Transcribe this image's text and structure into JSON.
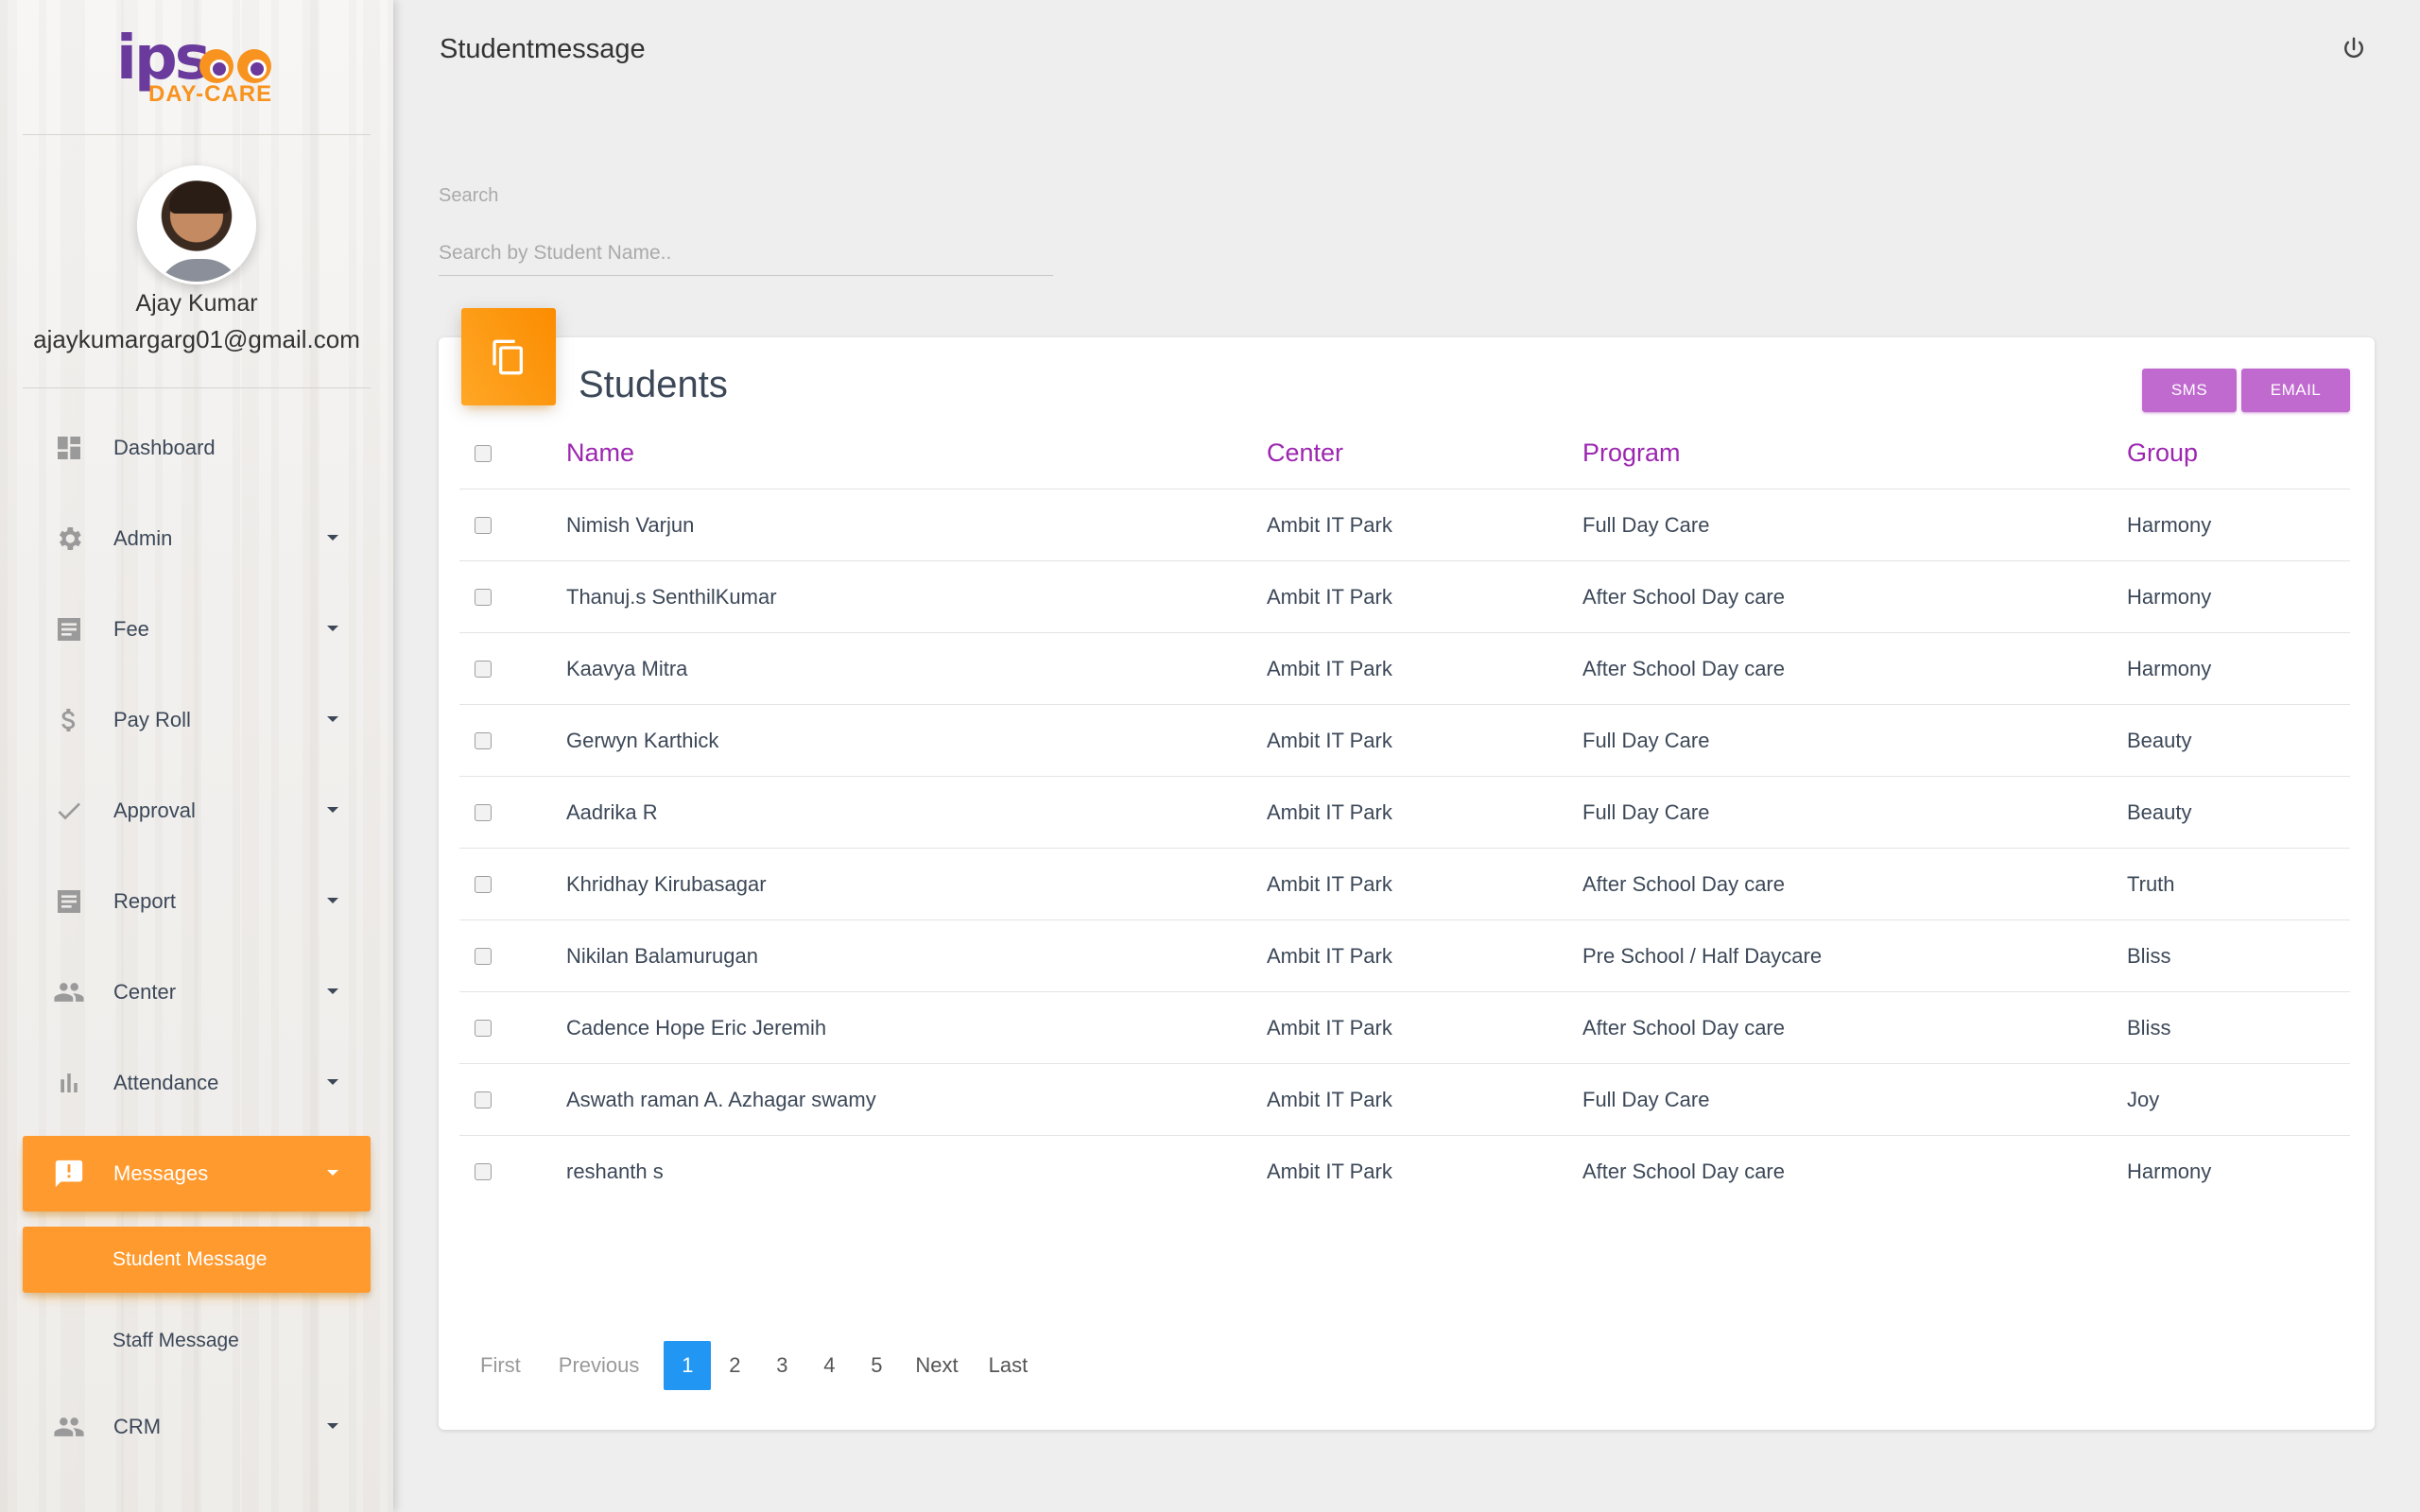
{
  "brand": {
    "logo_main": "ips",
    "logo_sub": "DAY-CARE"
  },
  "user": {
    "name": "Ajay Kumar",
    "email": "ajaykumargarg01@gmail.com"
  },
  "sidebar": {
    "items": [
      {
        "label": "Dashboard",
        "icon": "dashboard-icon"
      },
      {
        "label": "Admin",
        "icon": "gear-icon"
      },
      {
        "label": "Fee",
        "icon": "receipt-icon"
      },
      {
        "label": "Pay Roll",
        "icon": "dollar-icon"
      },
      {
        "label": "Approval",
        "icon": "check-icon"
      },
      {
        "label": "Report",
        "icon": "report-icon"
      },
      {
        "label": "Center",
        "icon": "people-icon"
      },
      {
        "label": "Attendance",
        "icon": "bar-chart-icon"
      },
      {
        "label": "Messages",
        "icon": "message-alert-icon"
      },
      {
        "label": "CRM",
        "icon": "people-icon"
      }
    ],
    "sub_items": [
      {
        "label": "Student Message"
      },
      {
        "label": "Staff Message"
      }
    ]
  },
  "header": {
    "title": "Studentmessage"
  },
  "search": {
    "label": "Search",
    "placeholder": "Search by Student Name.."
  },
  "card": {
    "title": "Students",
    "sms_label": "SMS",
    "email_label": "EMAIL"
  },
  "table": {
    "headers": [
      "Name",
      "Center",
      "Program",
      "Group"
    ],
    "rows": [
      [
        "Nimish Varjun",
        "Ambit IT Park",
        "Full Day Care",
        "Harmony"
      ],
      [
        "Thanuj.s SenthilKumar",
        "Ambit IT Park",
        "After School Day care",
        "Harmony"
      ],
      [
        "Kaavya Mitra",
        "Ambit IT Park",
        "After School Day care",
        "Harmony"
      ],
      [
        "Gerwyn Karthick",
        "Ambit IT Park",
        "Full Day Care",
        "Beauty"
      ],
      [
        "Aadrika R",
        "Ambit IT Park",
        "Full Day Care",
        "Beauty"
      ],
      [
        "Khridhay Kirubasagar",
        "Ambit IT Park",
        "After School Day care",
        "Truth"
      ],
      [
        "Nikilan Balamurugan",
        "Ambit IT Park",
        "Pre School / Half Daycare",
        "Bliss"
      ],
      [
        "Cadence Hope Eric Jeremih",
        "Ambit IT Park",
        "After School Day care",
        "Bliss"
      ],
      [
        "Aswath raman A. Azhagar swamy",
        "Ambit IT Park",
        "Full Day Care",
        "Joy"
      ],
      [
        "reshanth s",
        "Ambit IT Park",
        "After School Day care",
        "Harmony"
      ]
    ]
  },
  "pagination": {
    "first": "First",
    "previous": "Previous",
    "pages": [
      "1",
      "2",
      "3",
      "4",
      "5"
    ],
    "current": "1",
    "next": "Next",
    "last": "Last"
  },
  "colors": {
    "accent_orange": "#ff9a2e",
    "accent_purple": "#9c27b0",
    "button_purple": "#c06ad0",
    "pagination_blue": "#2196f3"
  }
}
